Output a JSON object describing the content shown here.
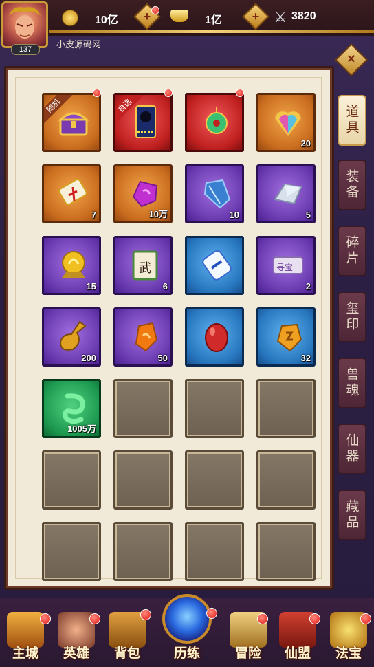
{
  "header": {
    "player_level": "137",
    "username": "小皮源码网",
    "currencies": [
      {
        "icon": "copper-coin-icon",
        "value": "10亿"
      },
      {
        "icon": "gold-ingot-icon",
        "value": "1亿"
      }
    ],
    "power": {
      "icon": "crossed-swords-icon",
      "value": "3820"
    }
  },
  "colors": {
    "accent_gold": "#f4d27a",
    "panel_bg": "#f2ead8",
    "badge_red": "#e01818"
  },
  "inventory": {
    "items": [
      {
        "icon": "treasure-chest-icon",
        "quality": "orange",
        "count": "",
        "tag": "随机",
        "badge": true
      },
      {
        "icon": "hero-card-icon",
        "quality": "red",
        "count": "",
        "tag": "自选",
        "badge": true
      },
      {
        "icon": "jade-pendant-icon",
        "quality": "red",
        "count": "",
        "tag": "",
        "badge": true
      },
      {
        "icon": "rainbow-gem-icon",
        "quality": "orange",
        "count": "20",
        "tag": "",
        "badge": false
      },
      {
        "icon": "scroll-ribbon-icon",
        "quality": "orange",
        "count": "7",
        "tag": "",
        "badge": false
      },
      {
        "icon": "purple-stone-icon",
        "quality": "orange",
        "count": "10万",
        "tag": "",
        "badge": false
      },
      {
        "icon": "crystal-icon",
        "quality": "purple",
        "count": "10",
        "tag": "",
        "badge": false
      },
      {
        "icon": "silver-ingot-icon",
        "quality": "purple",
        "count": "5",
        "tag": "",
        "badge": false
      },
      {
        "icon": "golden-orb-icon",
        "quality": "purple",
        "count": "15",
        "tag": "",
        "badge": false
      },
      {
        "icon": "martial-scroll-icon",
        "quality": "purple",
        "count": "6",
        "tag": "",
        "badge": false
      },
      {
        "icon": "blue-scroll-icon",
        "quality": "blue",
        "count": "",
        "tag": "",
        "badge": false
      },
      {
        "icon": "treasure-ticket-icon",
        "quality": "purple",
        "count": "2",
        "tag": "",
        "badge": false
      },
      {
        "icon": "gourd-potion-icon",
        "quality": "purple",
        "count": "200",
        "tag": "",
        "badge": false
      },
      {
        "icon": "orange-stone-icon",
        "quality": "purple",
        "count": "50",
        "tag": "",
        "badge": false
      },
      {
        "icon": "red-egg-icon",
        "quality": "blue",
        "count": "",
        "tag": "",
        "badge": false
      },
      {
        "icon": "gold-rune-stone-icon",
        "quality": "blue",
        "count": "32",
        "tag": "",
        "badge": false
      },
      {
        "icon": "jade-dragon-icon",
        "quality": "green",
        "count": "1005万",
        "tag": "",
        "badge": false
      }
    ],
    "ticket_text": "寻宝",
    "scroll_text": "武",
    "empty_slots": 11
  },
  "tabs": [
    "道具",
    "装备",
    "碎片",
    "玺印",
    "兽魂",
    "仙器",
    "藏品"
  ],
  "active_tab": "道具",
  "nav": [
    {
      "label": "主城",
      "badge": true
    },
    {
      "label": "英雄",
      "badge": true
    },
    {
      "label": "背包",
      "badge": true
    },
    {
      "label": "历练",
      "badge": true
    },
    {
      "label": "冒险",
      "badge": true
    },
    {
      "label": "仙盟",
      "badge": true
    },
    {
      "label": "法宝",
      "badge": true
    }
  ]
}
